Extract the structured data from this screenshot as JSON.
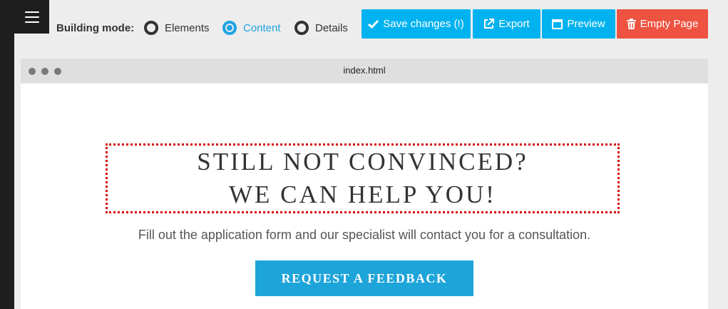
{
  "toolbar": {
    "menu_icon": "hamburger-menu-icon",
    "building_mode_label": "Building mode:",
    "modes": [
      {
        "label": "Elements",
        "selected": false
      },
      {
        "label": "Content",
        "selected": true
      },
      {
        "label": "Details",
        "selected": false
      }
    ],
    "buttons": {
      "save": {
        "label": "Save changes (!)",
        "icon": "check-icon"
      },
      "export": {
        "label": "Export",
        "icon": "external-link-icon"
      },
      "preview": {
        "label": "Preview",
        "icon": "window-icon"
      },
      "empty": {
        "label": "Empty Page",
        "icon": "trash-icon"
      }
    },
    "colors": {
      "accent": "#00b2f0",
      "danger": "#ee5240",
      "active_radio": "#1fa3e4"
    }
  },
  "browser": {
    "title": "index.html"
  },
  "page": {
    "headline_line1": "STILL NOT CONVINCED?",
    "headline_line2": "WE CAN HELP YOU!",
    "subtext": "Fill out the application form and our specialist will contact you for a consultation.",
    "cta_label": "REQUEST A FEEDBACK",
    "colors": {
      "cta": "#1da4d9",
      "selection_outline": "#d60000"
    }
  }
}
